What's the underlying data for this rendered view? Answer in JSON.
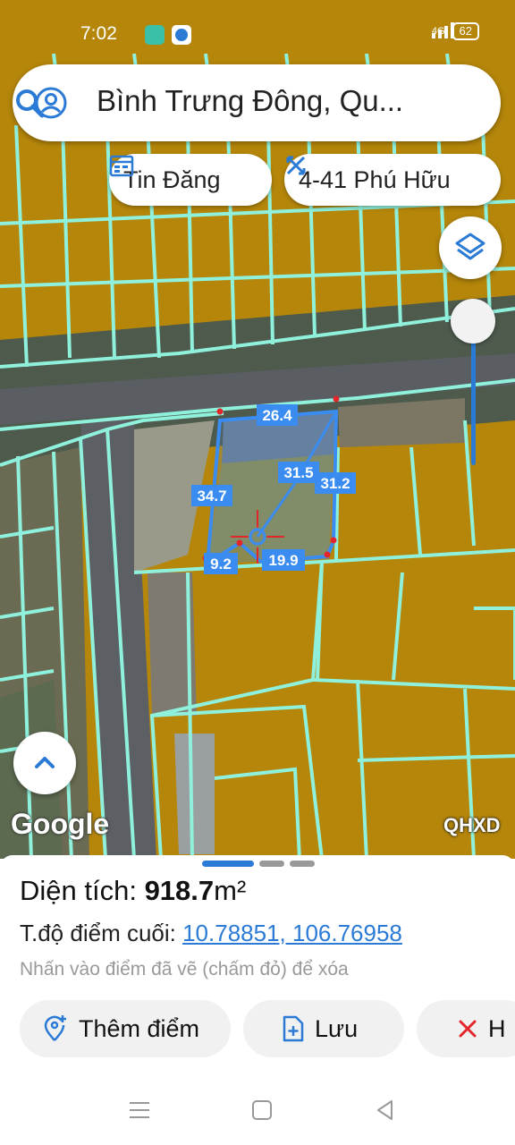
{
  "status_bar": {
    "time": "7:02",
    "network": "4G",
    "battery": "62"
  },
  "search": {
    "query": "Bình Trưng Đông, Qu..."
  },
  "chips": {
    "news_label": "Tin Đăng",
    "address_label": "4-41 Phú Hữu"
  },
  "map": {
    "measurements": [
      "26.4",
      "34.7",
      "31.5",
      "31.2",
      "9.2",
      "19.9"
    ],
    "google_label": "Google",
    "layer_label": "QHXD",
    "colors": {
      "parcel": "#b5860a",
      "boundary": "#8ff0dc",
      "polygon": "#3b8cf0",
      "vertex": "#e3262b"
    }
  },
  "sheet": {
    "area_label": "Diện tích: ",
    "area_value": "918.7",
    "area_unit": "m²",
    "coord_label": "T.độ điểm cuối: ",
    "coord_value": "10.78851, 106.76958",
    "hint": "Nhấn vào điểm đã vẽ (chấm đỏ) để xóa",
    "add_point_label": "Thêm điểm",
    "save_label": "Lưu",
    "cancel_label": "H"
  },
  "icons": [
    "user-circle-icon",
    "search-icon",
    "calendar-icon",
    "ruler-icon",
    "layers-icon",
    "chevron-up-icon",
    "add-location-icon",
    "save-file-icon",
    "close-icon",
    "menu-icon",
    "home-icon",
    "back-icon"
  ]
}
